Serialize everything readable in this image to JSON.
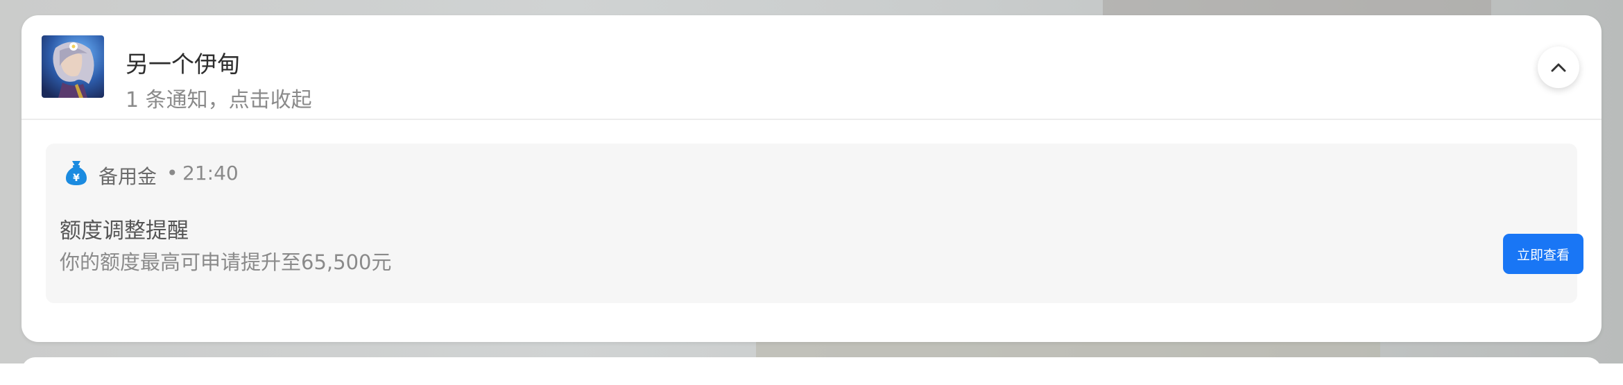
{
  "group": {
    "app_name": "另一个伊甸",
    "subtitle": "1 条通知，点击收起",
    "app_icon": "game-character-avatar",
    "collapse_icon": "chevron-up-icon"
  },
  "notification": {
    "source_icon": "money-bag-yuan-icon",
    "source": "备用金",
    "separator": "•",
    "time": "21:40",
    "title": "额度调整提醒",
    "body": "你的额度最高可申请提升至65,500元",
    "action_label": "立即查看"
  },
  "colors": {
    "accent": "#1976f5",
    "icon_blue": "#1b8be0"
  }
}
